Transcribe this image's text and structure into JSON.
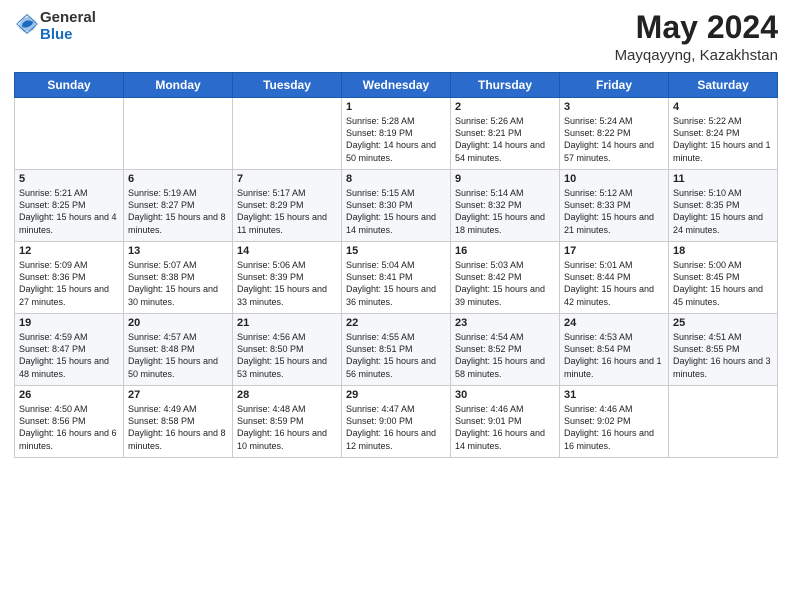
{
  "header": {
    "logo_general": "General",
    "logo_blue": "Blue",
    "title": "May 2024",
    "location": "Mayqayyng, Kazakhstan"
  },
  "days_of_week": [
    "Sunday",
    "Monday",
    "Tuesday",
    "Wednesday",
    "Thursday",
    "Friday",
    "Saturday"
  ],
  "weeks": [
    [
      {
        "date": "",
        "sunrise": "",
        "sunset": "",
        "daylight": ""
      },
      {
        "date": "",
        "sunrise": "",
        "sunset": "",
        "daylight": ""
      },
      {
        "date": "",
        "sunrise": "",
        "sunset": "",
        "daylight": ""
      },
      {
        "date": "1",
        "sunrise": "Sunrise: 5:28 AM",
        "sunset": "Sunset: 8:19 PM",
        "daylight": "Daylight: 14 hours and 50 minutes."
      },
      {
        "date": "2",
        "sunrise": "Sunrise: 5:26 AM",
        "sunset": "Sunset: 8:21 PM",
        "daylight": "Daylight: 14 hours and 54 minutes."
      },
      {
        "date": "3",
        "sunrise": "Sunrise: 5:24 AM",
        "sunset": "Sunset: 8:22 PM",
        "daylight": "Daylight: 14 hours and 57 minutes."
      },
      {
        "date": "4",
        "sunrise": "Sunrise: 5:22 AM",
        "sunset": "Sunset: 8:24 PM",
        "daylight": "Daylight: 15 hours and 1 minute."
      }
    ],
    [
      {
        "date": "5",
        "sunrise": "Sunrise: 5:21 AM",
        "sunset": "Sunset: 8:25 PM",
        "daylight": "Daylight: 15 hours and 4 minutes."
      },
      {
        "date": "6",
        "sunrise": "Sunrise: 5:19 AM",
        "sunset": "Sunset: 8:27 PM",
        "daylight": "Daylight: 15 hours and 8 minutes."
      },
      {
        "date": "7",
        "sunrise": "Sunrise: 5:17 AM",
        "sunset": "Sunset: 8:29 PM",
        "daylight": "Daylight: 15 hours and 11 minutes."
      },
      {
        "date": "8",
        "sunrise": "Sunrise: 5:15 AM",
        "sunset": "Sunset: 8:30 PM",
        "daylight": "Daylight: 15 hours and 14 minutes."
      },
      {
        "date": "9",
        "sunrise": "Sunrise: 5:14 AM",
        "sunset": "Sunset: 8:32 PM",
        "daylight": "Daylight: 15 hours and 18 minutes."
      },
      {
        "date": "10",
        "sunrise": "Sunrise: 5:12 AM",
        "sunset": "Sunset: 8:33 PM",
        "daylight": "Daylight: 15 hours and 21 minutes."
      },
      {
        "date": "11",
        "sunrise": "Sunrise: 5:10 AM",
        "sunset": "Sunset: 8:35 PM",
        "daylight": "Daylight: 15 hours and 24 minutes."
      }
    ],
    [
      {
        "date": "12",
        "sunrise": "Sunrise: 5:09 AM",
        "sunset": "Sunset: 8:36 PM",
        "daylight": "Daylight: 15 hours and 27 minutes."
      },
      {
        "date": "13",
        "sunrise": "Sunrise: 5:07 AM",
        "sunset": "Sunset: 8:38 PM",
        "daylight": "Daylight: 15 hours and 30 minutes."
      },
      {
        "date": "14",
        "sunrise": "Sunrise: 5:06 AM",
        "sunset": "Sunset: 8:39 PM",
        "daylight": "Daylight: 15 hours and 33 minutes."
      },
      {
        "date": "15",
        "sunrise": "Sunrise: 5:04 AM",
        "sunset": "Sunset: 8:41 PM",
        "daylight": "Daylight: 15 hours and 36 minutes."
      },
      {
        "date": "16",
        "sunrise": "Sunrise: 5:03 AM",
        "sunset": "Sunset: 8:42 PM",
        "daylight": "Daylight: 15 hours and 39 minutes."
      },
      {
        "date": "17",
        "sunrise": "Sunrise: 5:01 AM",
        "sunset": "Sunset: 8:44 PM",
        "daylight": "Daylight: 15 hours and 42 minutes."
      },
      {
        "date": "18",
        "sunrise": "Sunrise: 5:00 AM",
        "sunset": "Sunset: 8:45 PM",
        "daylight": "Daylight: 15 hours and 45 minutes."
      }
    ],
    [
      {
        "date": "19",
        "sunrise": "Sunrise: 4:59 AM",
        "sunset": "Sunset: 8:47 PM",
        "daylight": "Daylight: 15 hours and 48 minutes."
      },
      {
        "date": "20",
        "sunrise": "Sunrise: 4:57 AM",
        "sunset": "Sunset: 8:48 PM",
        "daylight": "Daylight: 15 hours and 50 minutes."
      },
      {
        "date": "21",
        "sunrise": "Sunrise: 4:56 AM",
        "sunset": "Sunset: 8:50 PM",
        "daylight": "Daylight: 15 hours and 53 minutes."
      },
      {
        "date": "22",
        "sunrise": "Sunrise: 4:55 AM",
        "sunset": "Sunset: 8:51 PM",
        "daylight": "Daylight: 15 hours and 56 minutes."
      },
      {
        "date": "23",
        "sunrise": "Sunrise: 4:54 AM",
        "sunset": "Sunset: 8:52 PM",
        "daylight": "Daylight: 15 hours and 58 minutes."
      },
      {
        "date": "24",
        "sunrise": "Sunrise: 4:53 AM",
        "sunset": "Sunset: 8:54 PM",
        "daylight": "Daylight: 16 hours and 1 minute."
      },
      {
        "date": "25",
        "sunrise": "Sunrise: 4:51 AM",
        "sunset": "Sunset: 8:55 PM",
        "daylight": "Daylight: 16 hours and 3 minutes."
      }
    ],
    [
      {
        "date": "26",
        "sunrise": "Sunrise: 4:50 AM",
        "sunset": "Sunset: 8:56 PM",
        "daylight": "Daylight: 16 hours and 6 minutes."
      },
      {
        "date": "27",
        "sunrise": "Sunrise: 4:49 AM",
        "sunset": "Sunset: 8:58 PM",
        "daylight": "Daylight: 16 hours and 8 minutes."
      },
      {
        "date": "28",
        "sunrise": "Sunrise: 4:48 AM",
        "sunset": "Sunset: 8:59 PM",
        "daylight": "Daylight: 16 hours and 10 minutes."
      },
      {
        "date": "29",
        "sunrise": "Sunrise: 4:47 AM",
        "sunset": "Sunset: 9:00 PM",
        "daylight": "Daylight: 16 hours and 12 minutes."
      },
      {
        "date": "30",
        "sunrise": "Sunrise: 4:46 AM",
        "sunset": "Sunset: 9:01 PM",
        "daylight": "Daylight: 16 hours and 14 minutes."
      },
      {
        "date": "31",
        "sunrise": "Sunrise: 4:46 AM",
        "sunset": "Sunset: 9:02 PM",
        "daylight": "Daylight: 16 hours and 16 minutes."
      },
      {
        "date": "",
        "sunrise": "",
        "sunset": "",
        "daylight": ""
      }
    ]
  ]
}
